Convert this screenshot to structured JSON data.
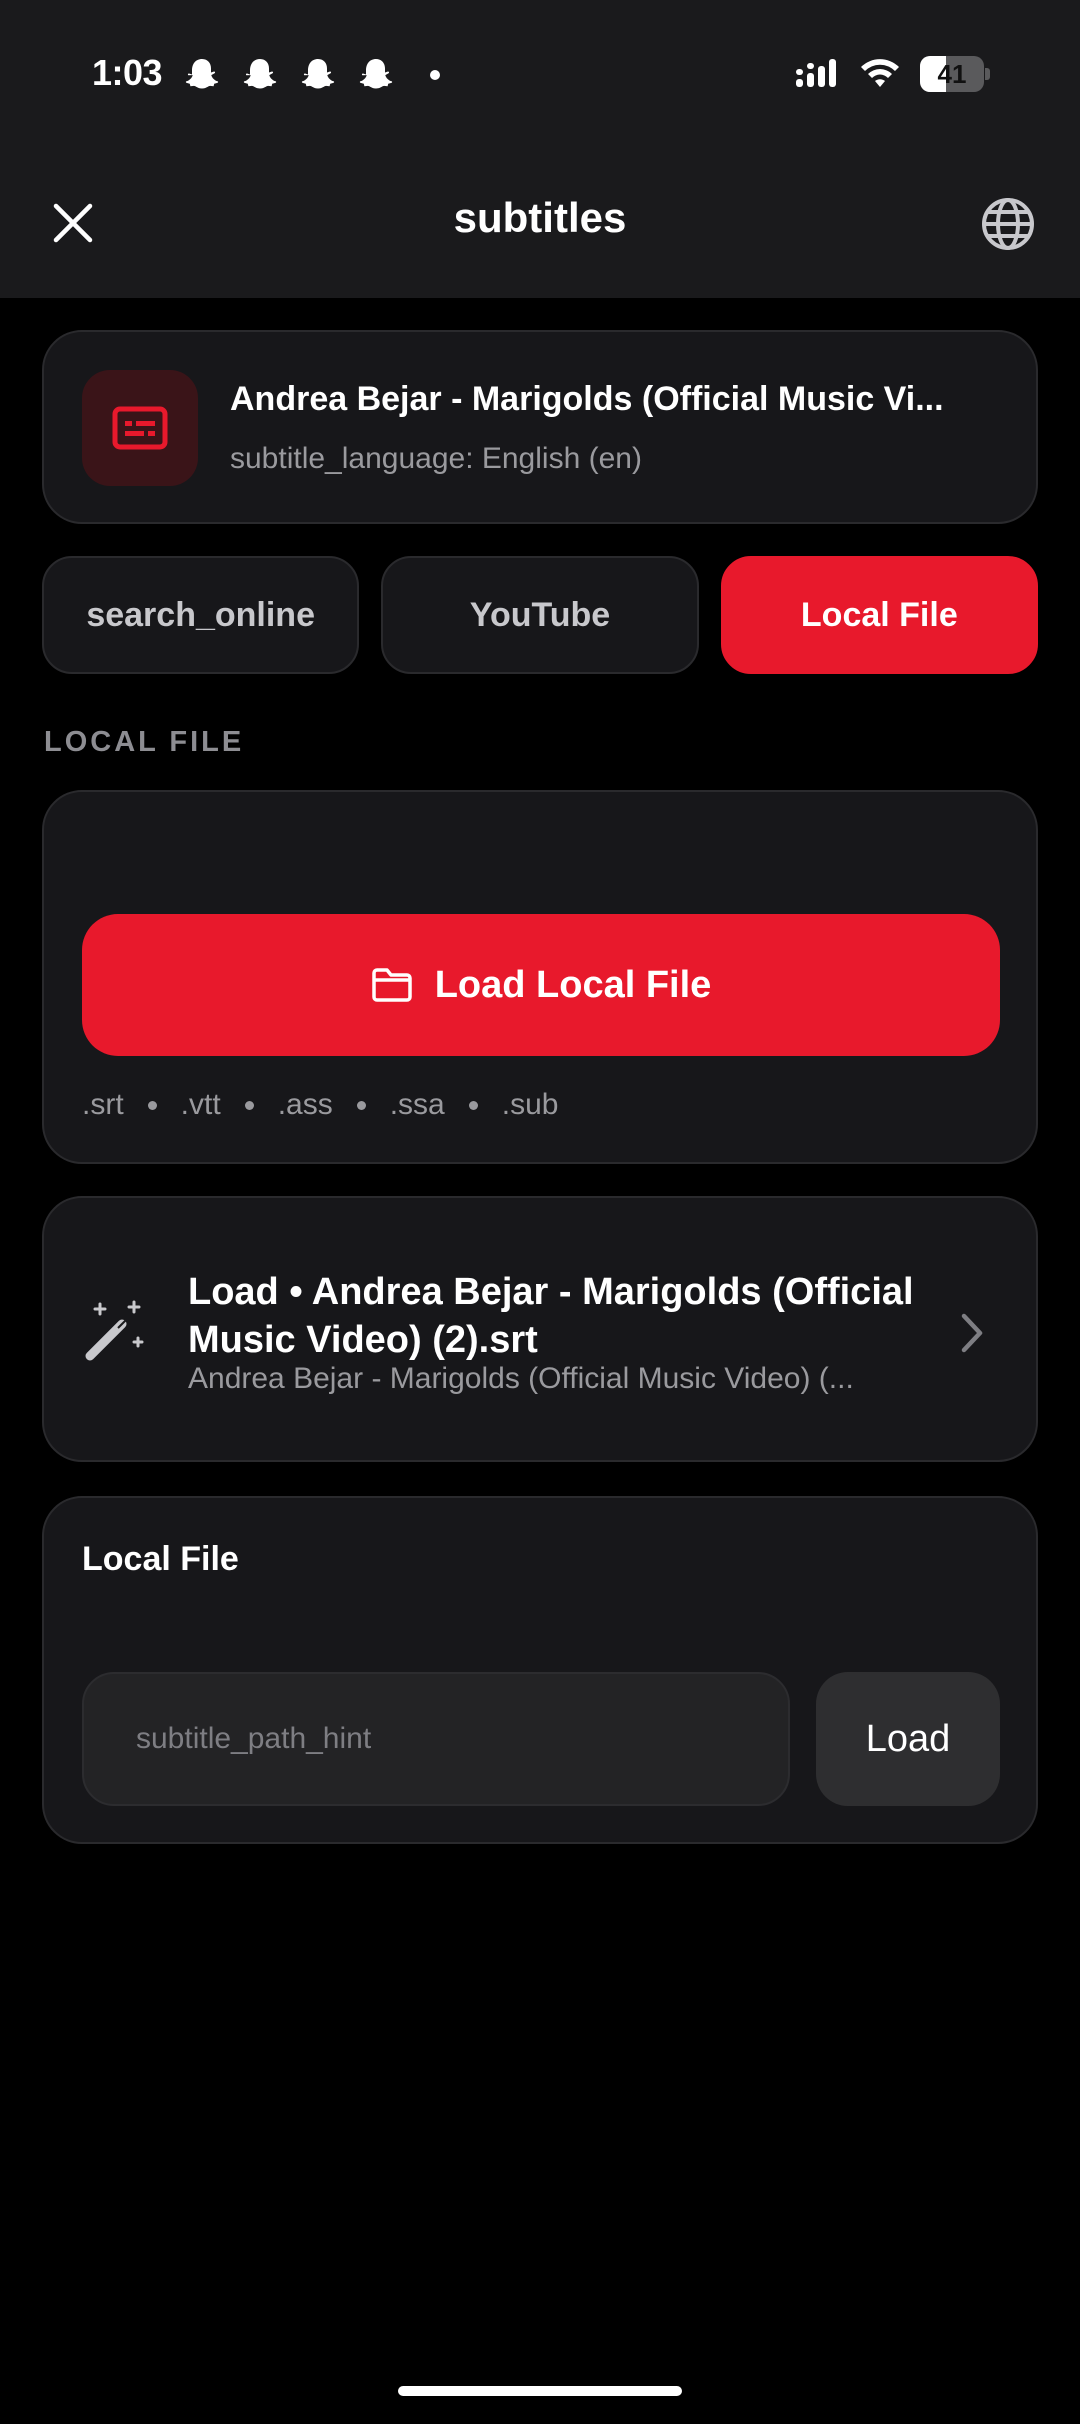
{
  "status_bar": {
    "time": "1:03",
    "notification_icons": [
      "snapchat-icon",
      "snapchat-icon",
      "snapchat-icon",
      "snapchat-icon"
    ],
    "battery_percent": "41",
    "battery_level": 0.41
  },
  "header": {
    "title": "subtitles",
    "close_icon": "close-icon",
    "language_icon": "globe-icon"
  },
  "video": {
    "title": "Andrea Bejar - Marigolds (Official Music Vi...",
    "subtitle_language": "subtitle_language: English (en)"
  },
  "tabs": [
    {
      "label": "search_online",
      "active": false
    },
    {
      "label": "YouTube",
      "active": false
    },
    {
      "label": "Local File",
      "active": true
    }
  ],
  "local_file": {
    "section_label": "LOCAL FILE",
    "load_button_label": "Load Local File",
    "extensions": [
      ".srt",
      ".vtt",
      ".ass",
      ".ssa",
      ".sub"
    ]
  },
  "recent": {
    "title": "Load • Andrea Bejar - Marigolds (Official Music Video) (2).srt",
    "subtitle": "Andrea Bejar - Marigolds (Official Music Video) (..."
  },
  "path_entry": {
    "label": "Local File",
    "placeholder": "subtitle_path_hint",
    "value": "",
    "load_label": "Load"
  },
  "colors": {
    "accent": "#e8192c",
    "card_bg": "#17171a",
    "header_bg": "#1a1a1c"
  }
}
